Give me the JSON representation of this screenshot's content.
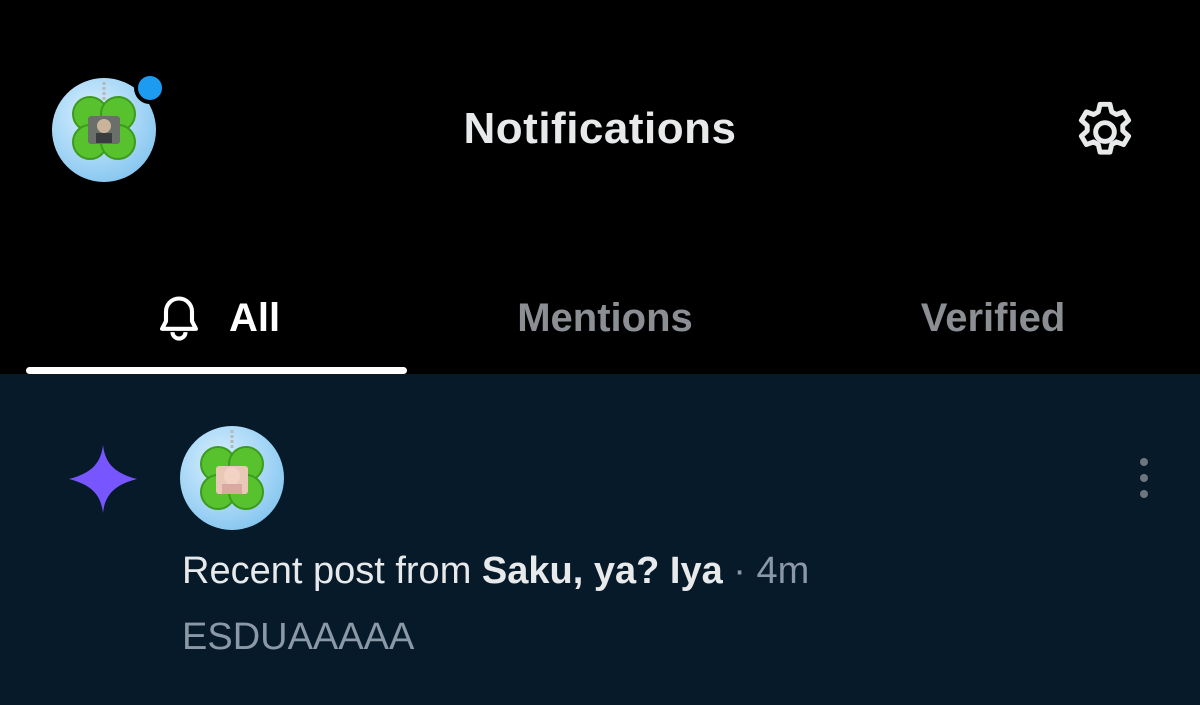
{
  "header": {
    "title": "Notifications",
    "avatar_icon": "clover-keychain-avatar",
    "settings_icon": "gear-icon",
    "unread_dot_color": "#1d9bf0"
  },
  "tabs": [
    {
      "label": "All",
      "active": true,
      "icon": "bell-icon"
    },
    {
      "label": "Mentions",
      "active": false
    },
    {
      "label": "Verified",
      "active": false
    }
  ],
  "notification": {
    "icon": "sparkle-icon",
    "icon_color": "#7856ff",
    "prefix": "Recent post from ",
    "user": "Saku, ya? Iya",
    "separator": " · ",
    "time": "4m",
    "preview": "ESDUAAAAA",
    "menu_icon": "more-vertical-icon"
  },
  "colors": {
    "background": "#000000",
    "row_background": "#061a2a",
    "text_primary": "#e7e9ea",
    "text_secondary": "#8b98a5"
  }
}
